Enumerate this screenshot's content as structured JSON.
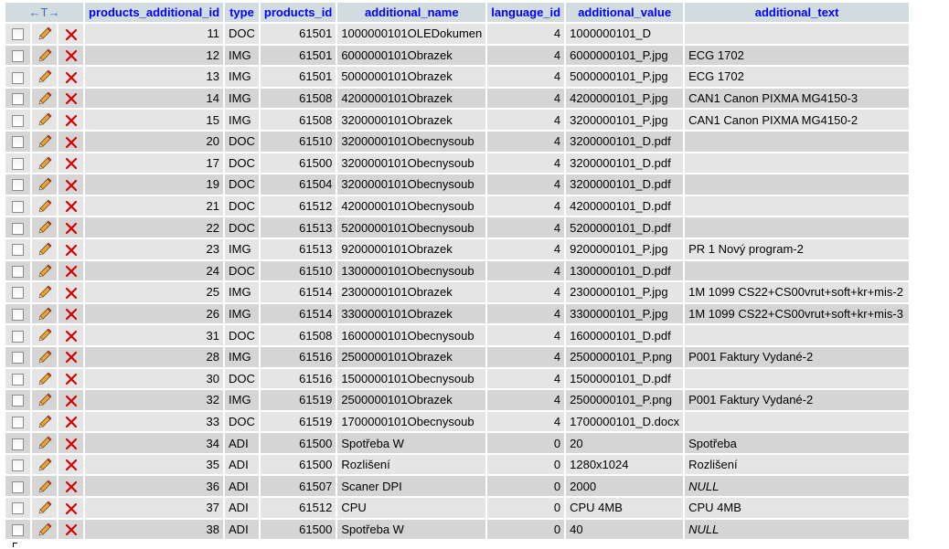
{
  "table": {
    "nav": {
      "left_arrow": "←",
      "middle": "T",
      "right_arrow": "→"
    },
    "columns": [
      "products_additional_id",
      "type",
      "products_id",
      "additional_name",
      "language_id",
      "additional_value",
      "additional_text"
    ],
    "rows": [
      {
        "products_additional_id": "11",
        "type": "DOC",
        "products_id": "61501",
        "additional_name": "1000000101OLEDokumen",
        "language_id": "4",
        "additional_value": "1000000101_D",
        "additional_text": ""
      },
      {
        "products_additional_id": "12",
        "type": "IMG",
        "products_id": "61501",
        "additional_name": "6000000101Obrazek",
        "language_id": "4",
        "additional_value": "6000000101_P.jpg",
        "additional_text": "ECG 1702"
      },
      {
        "products_additional_id": "13",
        "type": "IMG",
        "products_id": "61501",
        "additional_name": "5000000101Obrazek",
        "language_id": "4",
        "additional_value": "5000000101_P.jpg",
        "additional_text": "ECG 1702"
      },
      {
        "products_additional_id": "14",
        "type": "IMG",
        "products_id": "61508",
        "additional_name": "4200000101Obrazek",
        "language_id": "4",
        "additional_value": "4200000101_P.jpg",
        "additional_text": "CAN1 Canon PIXMA MG4150-3"
      },
      {
        "products_additional_id": "15",
        "type": "IMG",
        "products_id": "61508",
        "additional_name": "3200000101Obrazek",
        "language_id": "4",
        "additional_value": "3200000101_P.jpg",
        "additional_text": "CAN1 Canon PIXMA MG4150-2"
      },
      {
        "products_additional_id": "20",
        "type": "DOC",
        "products_id": "61510",
        "additional_name": "3200000101Obecnysoub",
        "language_id": "4",
        "additional_value": "3200000101_D.pdf",
        "additional_text": ""
      },
      {
        "products_additional_id": "17",
        "type": "DOC",
        "products_id": "61500",
        "additional_name": "3200000101Obecnysoub",
        "language_id": "4",
        "additional_value": "3200000101_D.pdf",
        "additional_text": ""
      },
      {
        "products_additional_id": "19",
        "type": "DOC",
        "products_id": "61504",
        "additional_name": "3200000101Obecnysoub",
        "language_id": "4",
        "additional_value": "3200000101_D.pdf",
        "additional_text": ""
      },
      {
        "products_additional_id": "21",
        "type": "DOC",
        "products_id": "61512",
        "additional_name": "4200000101Obecnysoub",
        "language_id": "4",
        "additional_value": "4200000101_D.pdf",
        "additional_text": ""
      },
      {
        "products_additional_id": "22",
        "type": "DOC",
        "products_id": "61513",
        "additional_name": "5200000101Obecnysoub",
        "language_id": "4",
        "additional_value": "5200000101_D.pdf",
        "additional_text": ""
      },
      {
        "products_additional_id": "23",
        "type": "IMG",
        "products_id": "61513",
        "additional_name": "9200000101Obrazek",
        "language_id": "4",
        "additional_value": "9200000101_P.jpg",
        "additional_text": "PR 1 Nový program-2"
      },
      {
        "products_additional_id": "24",
        "type": "DOC",
        "products_id": "61510",
        "additional_name": "1300000101Obecnysoub",
        "language_id": "4",
        "additional_value": "1300000101_D.pdf",
        "additional_text": ""
      },
      {
        "products_additional_id": "25",
        "type": "IMG",
        "products_id": "61514",
        "additional_name": "2300000101Obrazek",
        "language_id": "4",
        "additional_value": "2300000101_P.jpg",
        "additional_text": "1M 1099 CS22+CS00vrut+soft+kr+mis-2"
      },
      {
        "products_additional_id": "26",
        "type": "IMG",
        "products_id": "61514",
        "additional_name": "3300000101Obrazek",
        "language_id": "4",
        "additional_value": "3300000101_P.jpg",
        "additional_text": "1M 1099 CS22+CS00vrut+soft+kr+mis-3"
      },
      {
        "products_additional_id": "31",
        "type": "DOC",
        "products_id": "61508",
        "additional_name": "1600000101Obecnysoub",
        "language_id": "4",
        "additional_value": "1600000101_D.pdf",
        "additional_text": ""
      },
      {
        "products_additional_id": "28",
        "type": "IMG",
        "products_id": "61516",
        "additional_name": "2500000101Obrazek",
        "language_id": "4",
        "additional_value": "2500000101_P.png",
        "additional_text": "P001 Faktury Vydané-2"
      },
      {
        "products_additional_id": "30",
        "type": "DOC",
        "products_id": "61516",
        "additional_name": "1500000101Obecnysoub",
        "language_id": "4",
        "additional_value": "1500000101_D.pdf",
        "additional_text": ""
      },
      {
        "products_additional_id": "32",
        "type": "IMG",
        "products_id": "61519",
        "additional_name": "2500000101Obrazek",
        "language_id": "4",
        "additional_value": "2500000101_P.png",
        "additional_text": "P001 Faktury Vydané-2"
      },
      {
        "products_additional_id": "33",
        "type": "DOC",
        "products_id": "61519",
        "additional_name": "1700000101Obecnysoub",
        "language_id": "4",
        "additional_value": "1700000101_D.docx",
        "additional_text": ""
      },
      {
        "products_additional_id": "34",
        "type": "ADI",
        "products_id": "61500",
        "additional_name": "Spotřeba W",
        "language_id": "0",
        "additional_value": "20",
        "additional_text": "Spotřeba"
      },
      {
        "products_additional_id": "35",
        "type": "ADI",
        "products_id": "61500",
        "additional_name": "Rozlišení",
        "language_id": "0",
        "additional_value": "1280x1024",
        "additional_text": "Rozlišení"
      },
      {
        "products_additional_id": "36",
        "type": "ADI",
        "products_id": "61507",
        "additional_name": "Scaner DPI",
        "language_id": "0",
        "additional_value": "2000",
        "additional_text": "NULL",
        "text_is_null": true
      },
      {
        "products_additional_id": "37",
        "type": "ADI",
        "products_id": "61512",
        "additional_name": "CPU",
        "language_id": "0",
        "additional_value": "CPU 4MB",
        "additional_text": "CPU 4MB"
      },
      {
        "products_additional_id": "38",
        "type": "ADI",
        "products_id": "61500",
        "additional_name": "Spotřeba W",
        "language_id": "0",
        "additional_value": "40",
        "additional_text": "NULL",
        "text_is_null": true
      }
    ],
    "icons": {
      "checkbox": "checkbox-icon",
      "edit": "pencil-icon",
      "delete": "red-x-icon"
    },
    "colors": {
      "header_bg": "#d0dce0",
      "header_text": "#0000ff",
      "row_odd": "#e5e5e5",
      "row_even": "#d5d5d5",
      "delete_red": "#d40000"
    }
  }
}
